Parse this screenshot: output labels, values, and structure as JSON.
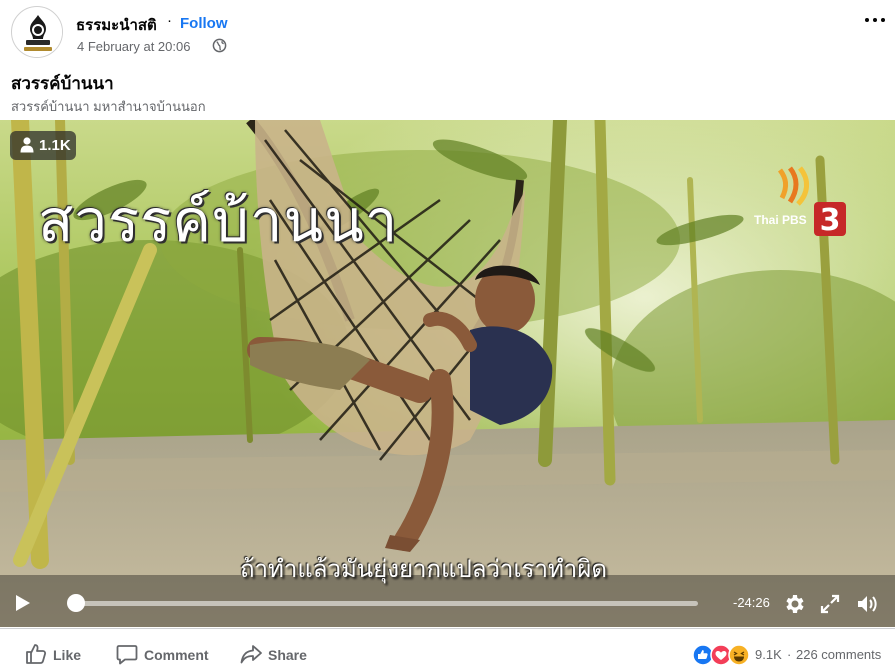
{
  "post": {
    "page_name": "ธรรมะนำสติ",
    "separator": "·",
    "follow_label": "Follow",
    "timestamp": "4 February at 20:06",
    "privacy_icon": "globe-icon",
    "title": "สวรรค์บ้านนา",
    "description": "สวรรค์บ้านนา มหาสำนาจบ้านนอก"
  },
  "video": {
    "viewer_count": "1.1K",
    "overlay_title": "สวรรค์บ้านนา",
    "subtitle": "ถ้าทำแล้วมันยุ่งยากแปลว่าเราทำผิด",
    "channel_logo_text": "Thai PBS",
    "channel_number": "3",
    "progress": 0.0,
    "remaining_time": "-24:26"
  },
  "actions": {
    "like_label": "Like",
    "comment_label": "Comment",
    "share_label": "Share"
  },
  "stats": {
    "reaction_count": "9.1K",
    "separator": "·",
    "comment_count": "226 comments"
  },
  "colors": {
    "accent": "#1877f2",
    "secondary_text": "#65676b",
    "like_reaction": "#1877f2",
    "love_reaction": "#f33e58",
    "haha_reaction": "#f7b125"
  }
}
